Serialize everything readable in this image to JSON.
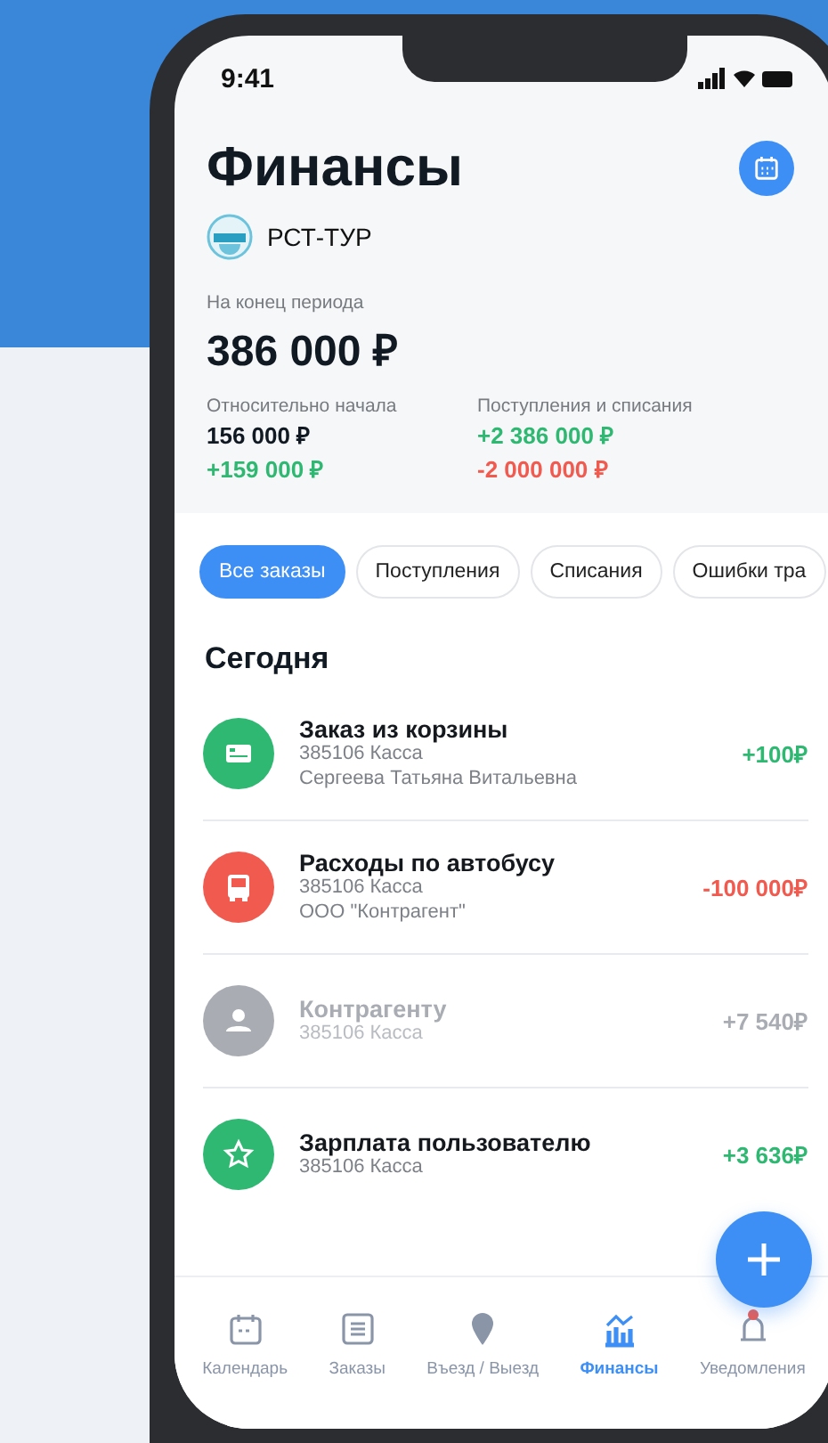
{
  "status_bar": {
    "time": "9:41"
  },
  "header": {
    "title": "Финансы",
    "company": "РСТ-ТУР"
  },
  "summary": {
    "period_label": "На конец периода",
    "period_total": "386 000 ₽",
    "relative_label": "Относительно начала",
    "relative_start": "156 000 ₽",
    "relative_change": "+159 000 ₽",
    "flow_label": "Поступления и списания",
    "flow_in": "+2 386 000 ₽",
    "flow_out": "-2 000 000 ₽"
  },
  "filters": [
    {
      "label": "Все заказы",
      "selected": true
    },
    {
      "label": "Поступления",
      "selected": false
    },
    {
      "label": "Списания",
      "selected": false
    },
    {
      "label": "Ошибки тра",
      "selected": false
    }
  ],
  "section_title": "Сегодня",
  "transactions": [
    {
      "kind": "order",
      "title": "Заказ из корзины",
      "lines": [
        "385106 Касса",
        "Сергеева Татьяна Витальевна"
      ],
      "amount": "+100₽"
    },
    {
      "kind": "expense",
      "title": "Расходы по автобусу",
      "lines": [
        "385106 Касса",
        "ООО \"Контрагент\""
      ],
      "amount": "-100 000₽"
    },
    {
      "kind": "transfer",
      "title": "Контрагенту",
      "lines": [
        "385106 Касса"
      ],
      "amount": "+7 540₽"
    },
    {
      "kind": "salary",
      "title": "Зарплата пользователю",
      "lines": [
        "385106 Касса"
      ],
      "amount": "+3 636₽"
    }
  ],
  "bottom_nav": [
    {
      "label": "Календарь",
      "selected": false,
      "alert": false
    },
    {
      "label": "Заказы",
      "selected": false,
      "alert": false
    },
    {
      "label": "Въезд / Выезд",
      "selected": false,
      "alert": false
    },
    {
      "label": "Финансы",
      "selected": true,
      "alert": false
    },
    {
      "label": "Уведомления",
      "selected": false,
      "alert": true
    }
  ]
}
